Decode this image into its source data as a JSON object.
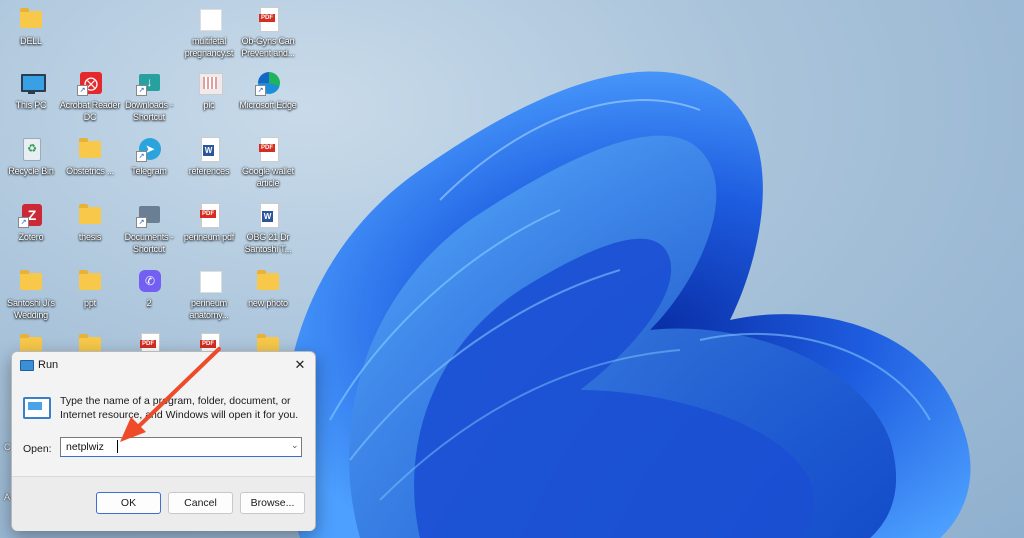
{
  "desktop": {
    "icons": [
      {
        "label": "DELL",
        "type": "folder"
      },
      {
        "label": "multifetal pregnancy.st",
        "type": "blank"
      },
      {
        "label": "Ob-Gyns Can Prevent and...",
        "type": "pdf"
      },
      {
        "label": "This PC",
        "type": "monitor"
      },
      {
        "label": "Acrobat Reader DC",
        "type": "acrobat"
      },
      {
        "label": "Downloads - Shortcut",
        "type": "downloads"
      },
      {
        "label": "pic",
        "type": "pic"
      },
      {
        "label": "Microsoft Edge",
        "type": "edge"
      },
      {
        "label": "Recycle Bin",
        "type": "recycle"
      },
      {
        "label": "Obstetrics ...",
        "type": "folder"
      },
      {
        "label": "Telegram",
        "type": "telegram"
      },
      {
        "label": "references",
        "type": "word"
      },
      {
        "label": "Google wallet article",
        "type": "pdf"
      },
      {
        "label": "Zotero",
        "type": "zotero"
      },
      {
        "label": "thesis",
        "type": "folder"
      },
      {
        "label": "Documents - Shortcut",
        "type": "documents"
      },
      {
        "label": "perineum pdf",
        "type": "pdf"
      },
      {
        "label": "OBG 21 Dr Santoshi T...",
        "type": "word"
      },
      {
        "label": "Santoshi Ji's Wedding",
        "type": "folder"
      },
      {
        "label": "ppt",
        "type": "folder"
      },
      {
        "label": "2",
        "type": "viber"
      },
      {
        "label": "perineum anatomy...",
        "type": "blank"
      },
      {
        "label": "new photo",
        "type": "folder"
      }
    ],
    "partial_labels": [
      "C",
      "A"
    ],
    "pdf_badge": "PDF",
    "word_badge": "W",
    "shortcut_arrow": "↗"
  },
  "run_dialog": {
    "title": "Run",
    "close_glyph": "✕",
    "description": "Type the name of a program, folder, document, or Internet resource, and Windows will open it for you.",
    "open_label": "Open:",
    "open_value": "netplwiz",
    "chevron": "⌄",
    "ok_label": "OK",
    "cancel_label": "Cancel",
    "browse_label": "Browse..."
  },
  "colors": {
    "annotation_arrow": "#ee4b2b",
    "wallpaper_blue": "#1e5de0"
  }
}
